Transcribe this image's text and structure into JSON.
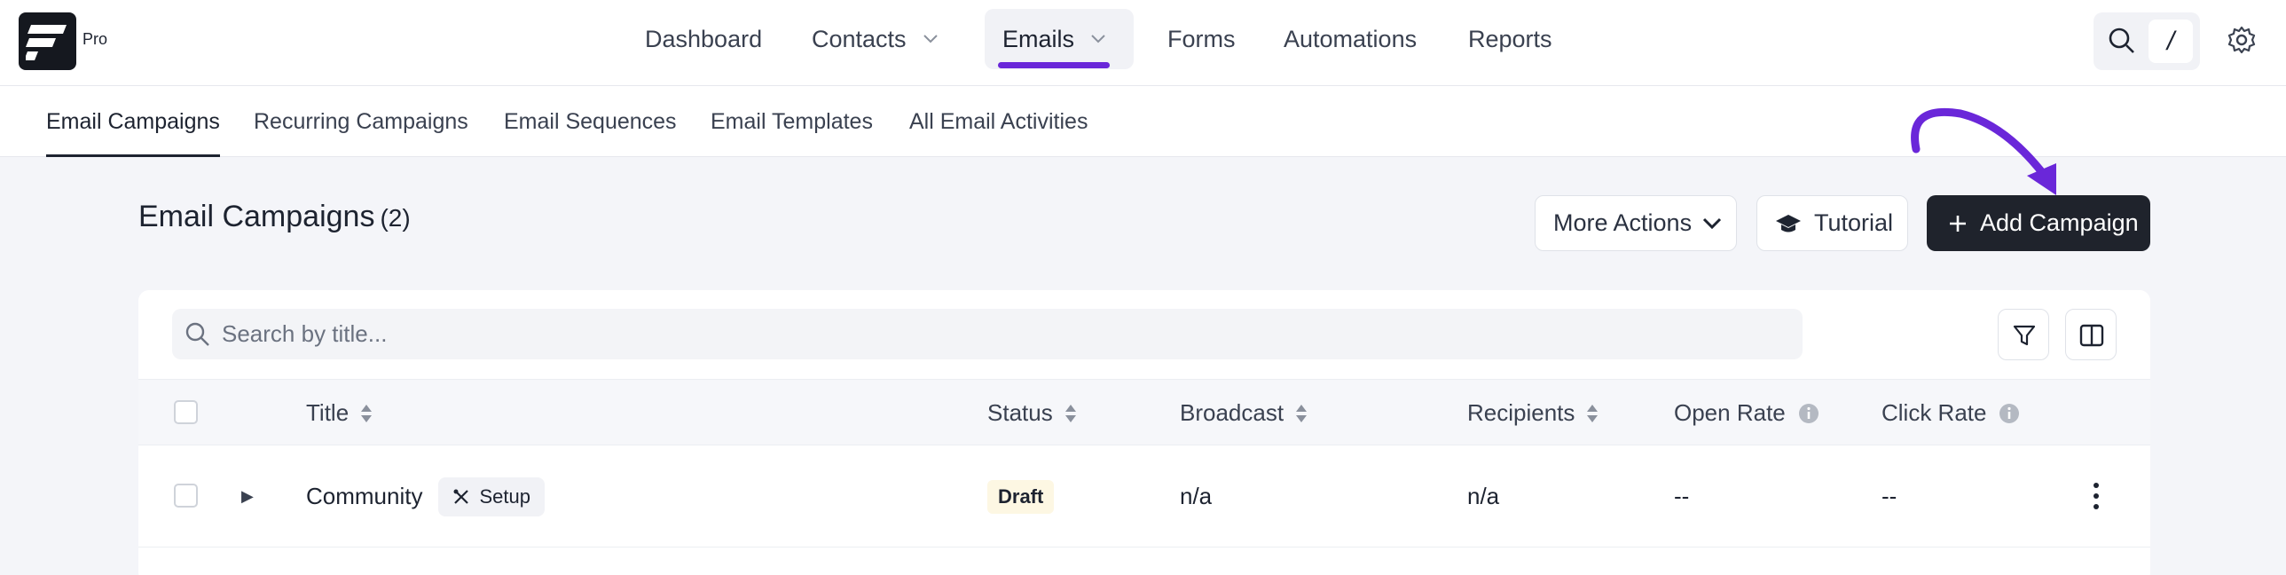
{
  "app": {
    "badge": "Pro"
  },
  "nav": {
    "items": [
      {
        "label": "Dashboard"
      },
      {
        "label": "Contacts"
      },
      {
        "label": "Emails"
      },
      {
        "label": "Forms"
      },
      {
        "label": "Automations"
      },
      {
        "label": "Reports"
      }
    ],
    "active": "Emails",
    "search_shortcut": "/"
  },
  "subnav": {
    "tabs": [
      {
        "label": "Email Campaigns"
      },
      {
        "label": "Recurring Campaigns"
      },
      {
        "label": "Email Sequences"
      },
      {
        "label": "Email Templates"
      },
      {
        "label": "All Email Activities"
      }
    ],
    "active": "Email Campaigns"
  },
  "page": {
    "title": "Email Campaigns",
    "count": "(2)",
    "more_actions": "More Actions",
    "tutorial": "Tutorial",
    "add_campaign": "Add Campaign"
  },
  "table": {
    "search_placeholder": "Search by title...",
    "columns": [
      "Title",
      "Status",
      "Broadcast",
      "Recipients",
      "Open Rate",
      "Click Rate"
    ],
    "rows": [
      {
        "title": "Community",
        "badge": "Setup",
        "status": "Draft",
        "broadcast": "n/a",
        "recipients": "n/a",
        "open_rate": "--",
        "click_rate": "--"
      }
    ]
  },
  "colors": {
    "accent": "#6a27d9",
    "dark_button": "#1f232c",
    "draft_bg": "#fdf7e3"
  }
}
